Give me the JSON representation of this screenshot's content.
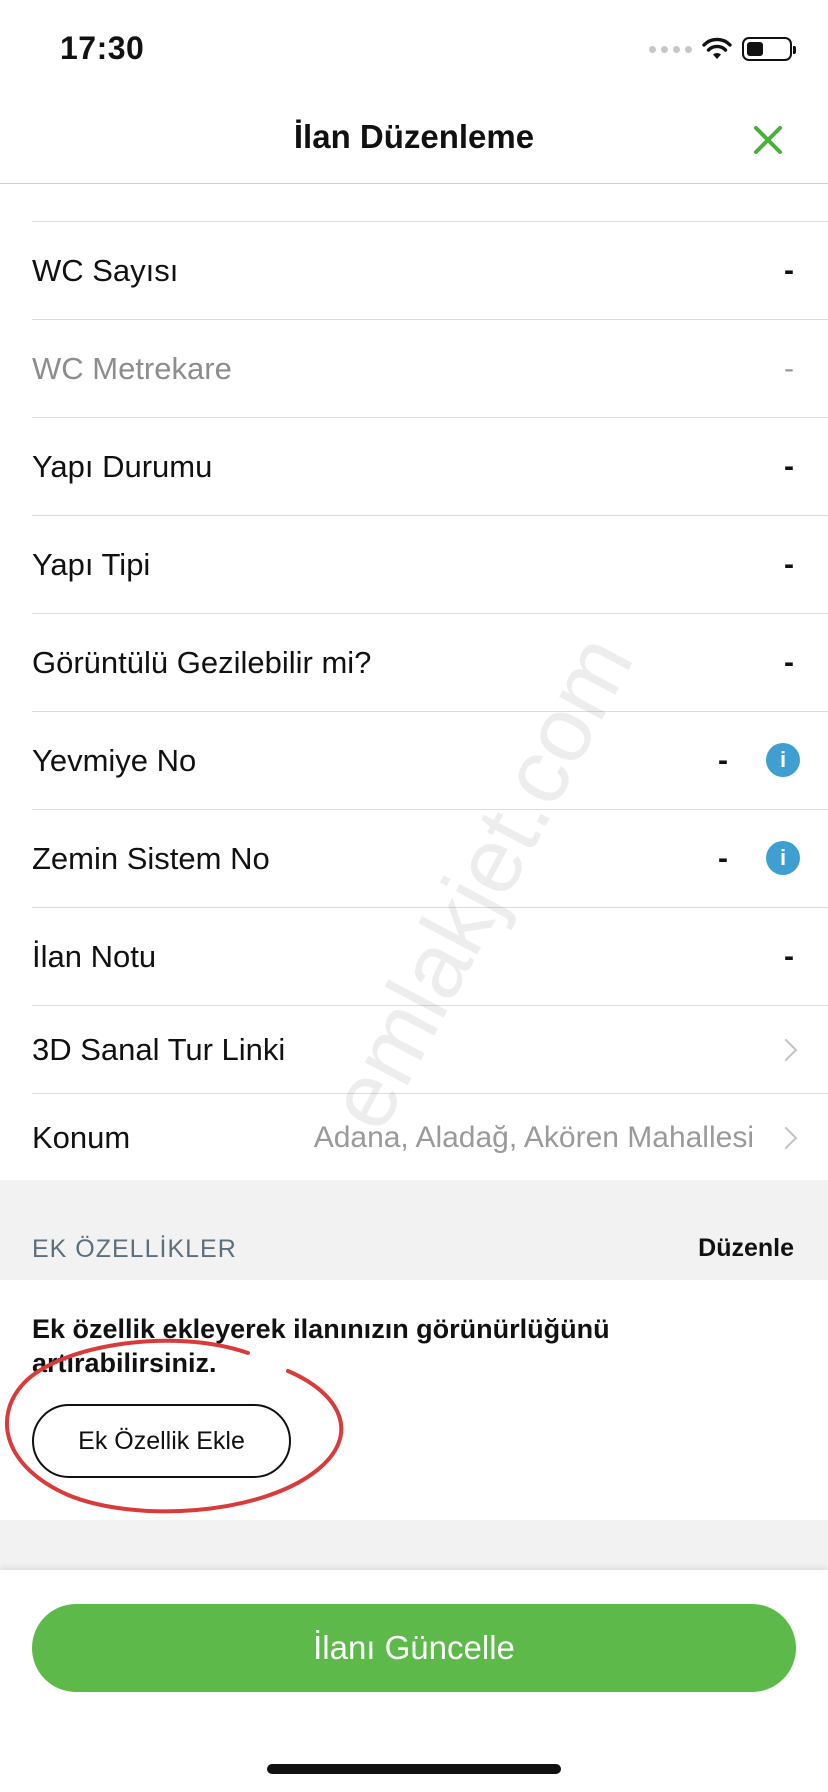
{
  "status_bar": {
    "time": "17:30"
  },
  "nav": {
    "title": "İlan Düzenleme",
    "close_icon": "close-icon",
    "accent_color": "#4cae3d"
  },
  "rows": [
    {
      "label": "WC Sayısı",
      "value": "-"
    },
    {
      "label": "WC Metrekare",
      "value": "-"
    },
    {
      "label": "Yapı Durumu",
      "value": "-"
    },
    {
      "label": "Yapı Tipi",
      "value": "-"
    },
    {
      "label": "Görüntülü Gezilebilir mi?",
      "value": "-"
    },
    {
      "label": "Yevmiye No",
      "value": "-",
      "info_icon": "i"
    },
    {
      "label": "Zemin Sistem No",
      "value": "-",
      "info_icon": "i"
    },
    {
      "label": "İlan Notu",
      "value": "-"
    },
    {
      "label": "3D Sanal Tur Linki"
    },
    {
      "label": "Konum",
      "value": "Adana, Aladağ, Akören Mahallesi"
    }
  ],
  "features_section": {
    "title": "EK ÖZELLİKLER",
    "action": "Düzenle",
    "description": "Ek özellik ekleyerek ilanınızın görünürlüğünü artırabilirsiniz.",
    "button": "Ek Özellik Ekle"
  },
  "footer": {
    "update_button": "İlanı Güncelle",
    "button_color": "#5cb94a"
  },
  "watermark": "emlakjet.com"
}
